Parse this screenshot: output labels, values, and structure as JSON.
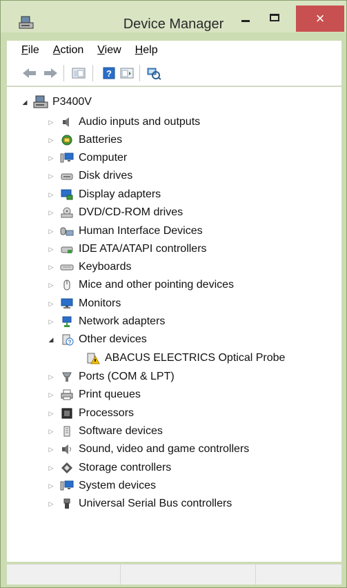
{
  "window": {
    "title": "Device Manager",
    "close_glyph": "×"
  },
  "menu": [
    {
      "label": "File",
      "accel": "F",
      "rest": "ile"
    },
    {
      "label": "Action",
      "accel": "A",
      "rest": "ction"
    },
    {
      "label": "View",
      "accel": "V",
      "rest": "iew"
    },
    {
      "label": "Help",
      "accel": "H",
      "rest": "elp"
    }
  ],
  "toolbar": {
    "buttons": [
      "back-arrow-icon",
      "forward-arrow-icon",
      "show-hide-console-tree-icon",
      "help-icon",
      "properties-icon",
      "scan-hardware-changes-icon"
    ]
  },
  "tree": {
    "root": {
      "label": "P3400V",
      "expanded": true
    },
    "items": [
      {
        "label": "Audio inputs and outputs",
        "icon": "speaker-icon"
      },
      {
        "label": "Batteries",
        "icon": "battery-icon"
      },
      {
        "label": "Computer",
        "icon": "computer-icon"
      },
      {
        "label": "Disk drives",
        "icon": "disk-drive-icon"
      },
      {
        "label": "Display adapters",
        "icon": "display-adapter-icon"
      },
      {
        "label": "DVD/CD-ROM drives",
        "icon": "dvd-drive-icon"
      },
      {
        "label": "Human Interface Devices",
        "icon": "hid-icon"
      },
      {
        "label": "IDE ATA/ATAPI controllers",
        "icon": "ide-controller-icon"
      },
      {
        "label": "Keyboards",
        "icon": "keyboard-icon"
      },
      {
        "label": "Mice and other pointing devices",
        "icon": "mouse-icon"
      },
      {
        "label": "Monitors",
        "icon": "monitor-icon"
      },
      {
        "label": "Network adapters",
        "icon": "network-adapter-icon"
      },
      {
        "label": "Other devices",
        "icon": "unknown-device-icon",
        "expanded": true
      },
      {
        "label": "ABACUS ELECTRICS Optical Probe",
        "icon": "warning-device-icon",
        "child": true
      },
      {
        "label": "Ports (COM & LPT)",
        "icon": "port-icon"
      },
      {
        "label": "Print queues",
        "icon": "printer-icon"
      },
      {
        "label": "Processors",
        "icon": "processor-icon"
      },
      {
        "label": "Software devices",
        "icon": "software-device-icon"
      },
      {
        "label": "Sound, video and game controllers",
        "icon": "sound-icon"
      },
      {
        "label": "Storage controllers",
        "icon": "storage-controller-icon"
      },
      {
        "label": "System devices",
        "icon": "system-device-icon"
      },
      {
        "label": "Universal Serial Bus controllers",
        "icon": "usb-icon"
      }
    ]
  },
  "colors": {
    "frame": "#ccdcb2",
    "close_button": "#c95050",
    "accent_blue": "#2a6fc9"
  }
}
